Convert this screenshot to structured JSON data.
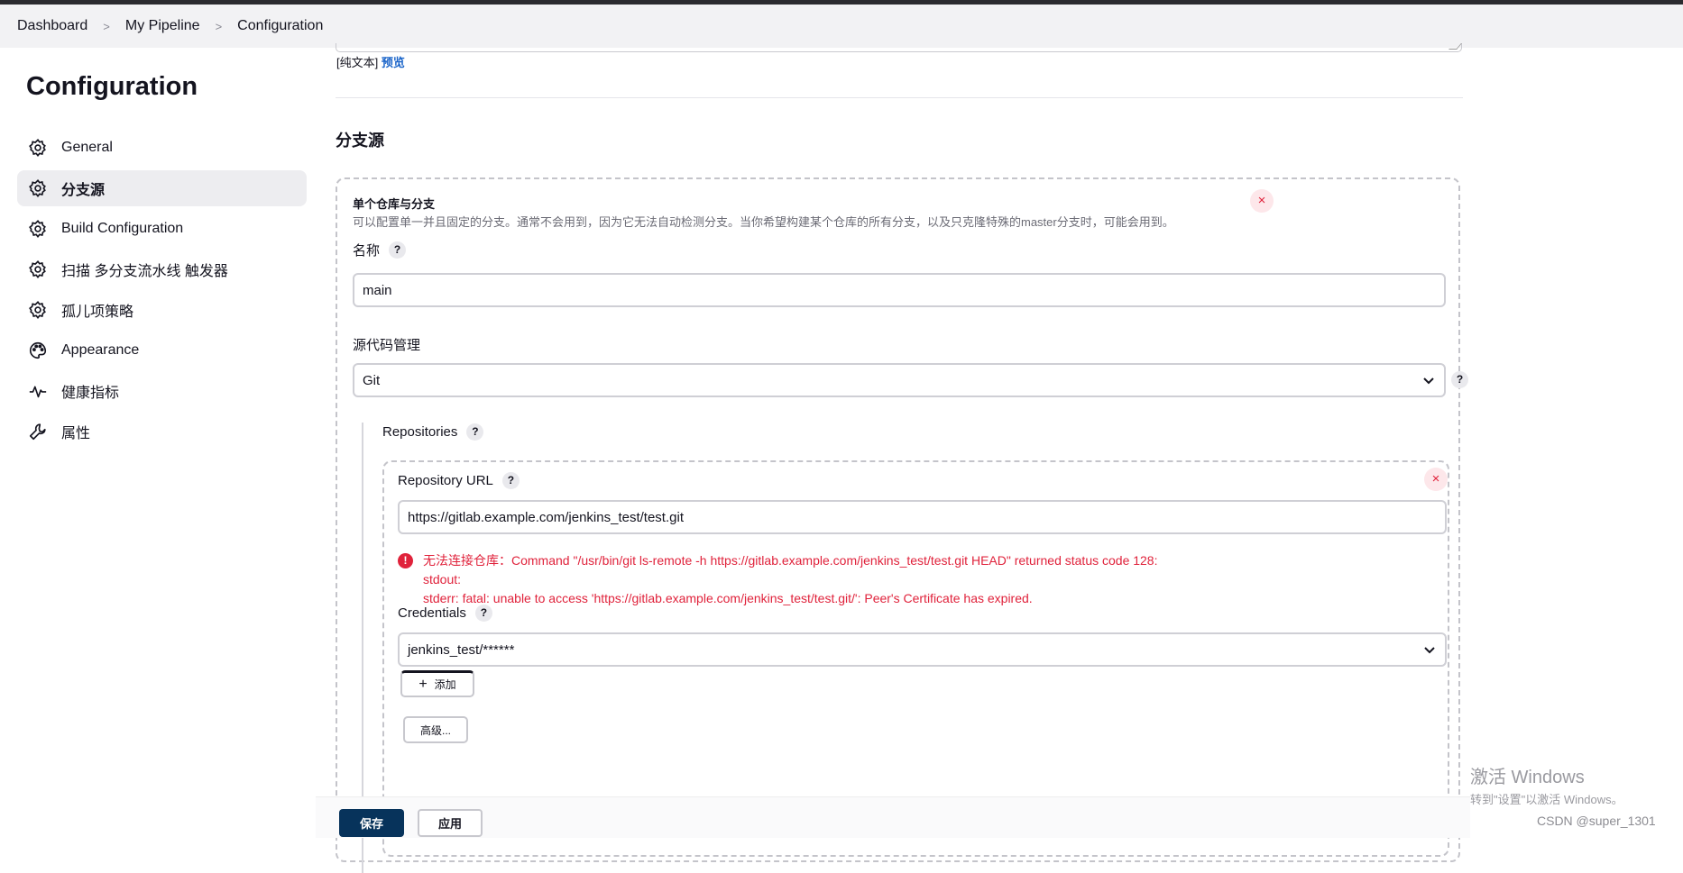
{
  "breadcrumbs": [
    "Dashboard",
    "My Pipeline",
    "Configuration"
  ],
  "page_title": "Configuration",
  "sidebar": {
    "items": [
      {
        "label": "General",
        "icon": "gear-icon",
        "active": false
      },
      {
        "label": "分支源",
        "icon": "gear-icon",
        "active": true
      },
      {
        "label": "Build Configuration",
        "icon": "gear-icon",
        "active": false
      },
      {
        "label": "扫描 多分支流水线 触发器",
        "icon": "gear-icon",
        "active": false
      },
      {
        "label": "孤儿项策略",
        "icon": "gear-icon",
        "active": false
      },
      {
        "label": "Appearance",
        "icon": "palette-icon",
        "active": false
      },
      {
        "label": "健康指标",
        "icon": "pulse-icon",
        "active": false
      },
      {
        "label": "属性",
        "icon": "wrench-icon",
        "active": false
      }
    ]
  },
  "description": {
    "plain_text_label": "[纯文本]",
    "preview_link": "预览"
  },
  "branch_sources": {
    "section_title": "分支源",
    "card": {
      "title": "单个仓库与分支",
      "description": "可以配置单一并且固定的分支。通常不会用到，因为它无法自动检测分支。当你希望构建某个仓库的所有分支，以及只克隆特殊的master分支时，可能会用到。",
      "close": "×",
      "name_label": "名称",
      "name_value": "main",
      "scm_label": "源代码管理",
      "scm_value": "Git",
      "repositories_label": "Repositories",
      "repository": {
        "close": "×",
        "url_label": "Repository URL",
        "url_value": "https://gitlab.example.com/jenkins_test/test.git",
        "error_icon": "!",
        "error_line1": "无法连接仓库：Command \"/usr/bin/git ls-remote -h https://gitlab.example.com/jenkins_test/test.git HEAD\" returned status code 128:",
        "error_line2": "stdout:",
        "error_line3": "stderr: fatal: unable to access 'https://gitlab.example.com/jenkins_test/test.git/': Peer's Certificate has expired.",
        "credentials_label": "Credentials",
        "credentials_value": "jenkins_test/******",
        "add_button": "添加",
        "add_icon": "+",
        "advanced_button": "高级..."
      }
    }
  },
  "help_glyph": "?",
  "footer": {
    "save": "保存",
    "apply": "应用"
  },
  "watermark": {
    "title": "激活 Windows",
    "subtitle": "转到\"设置\"以激活 Windows。"
  },
  "credit": "CSDN @super_1301"
}
